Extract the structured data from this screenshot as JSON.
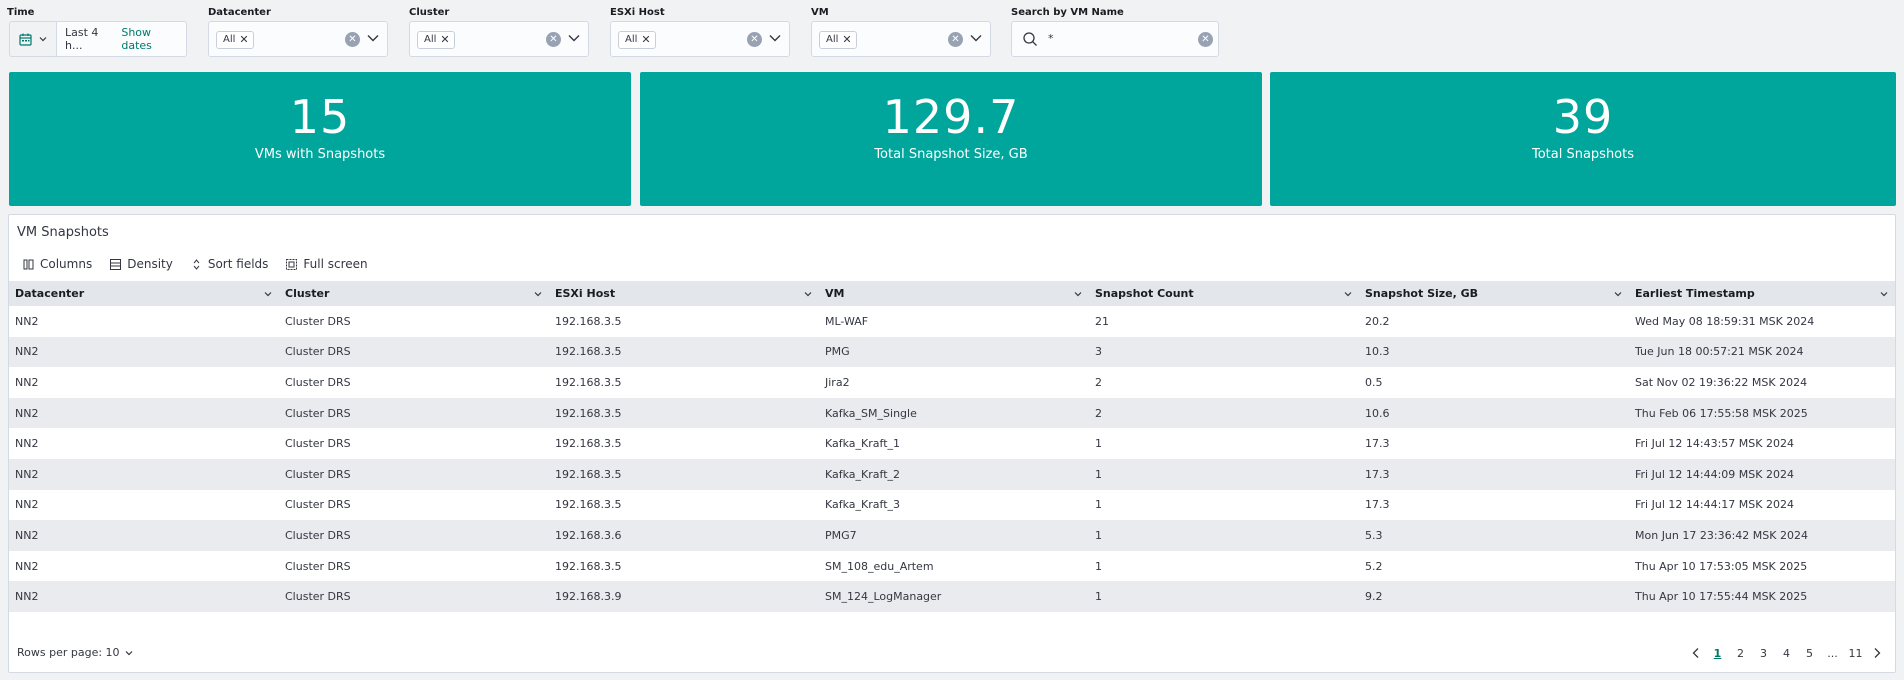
{
  "filters": {
    "time": {
      "label": "Time",
      "value": "Last 4 h...",
      "show_dates": "Show dates"
    },
    "datacenter": {
      "label": "Datacenter",
      "chip": "All"
    },
    "cluster": {
      "label": "Cluster",
      "chip": "All"
    },
    "esxi_host": {
      "label": "ESXi Host",
      "chip": "All"
    },
    "vm": {
      "label": "VM",
      "chip": "All"
    },
    "search": {
      "label": "Search by VM Name",
      "value": "*"
    }
  },
  "stats": [
    {
      "value": "15",
      "label": "VMs with Snapshots"
    },
    {
      "value": "129.7",
      "label": "Total Snapshot Size, GB"
    },
    {
      "value": "39",
      "label": "Total Snapshots"
    }
  ],
  "panel": {
    "title": "VM Snapshots",
    "toolbar": {
      "columns": "Columns",
      "density": "Density",
      "sort": "Sort fields",
      "fullscreen": "Full screen"
    },
    "columns": [
      "Datacenter",
      "Cluster",
      "ESXi Host",
      "VM",
      "Snapshot Count",
      "Snapshot Size, GB",
      "Earliest Timestamp"
    ],
    "rows": [
      [
        "NN2",
        "Cluster DRS",
        "192.168.3.5",
        "ML-WAF",
        "21",
        "20.2",
        "Wed May 08 18:59:31 MSK 2024"
      ],
      [
        "NN2",
        "Cluster DRS",
        "192.168.3.5",
        "PMG",
        "3",
        "10.3",
        "Tue Jun 18 00:57:21 MSK 2024"
      ],
      [
        "NN2",
        "Cluster DRS",
        "192.168.3.5",
        "Jira2",
        "2",
        "0.5",
        "Sat Nov 02 19:36:22 MSK 2024"
      ],
      [
        "NN2",
        "Cluster DRS",
        "192.168.3.5",
        "Kafka_SM_Single",
        "2",
        "10.6",
        "Thu Feb 06 17:55:58 MSK 2025"
      ],
      [
        "NN2",
        "Cluster DRS",
        "192.168.3.5",
        "Kafka_Kraft_1",
        "1",
        "17.3",
        "Fri Jul 12 14:43:57 MSK 2024"
      ],
      [
        "NN2",
        "Cluster DRS",
        "192.168.3.5",
        "Kafka_Kraft_2",
        "1",
        "17.3",
        "Fri Jul 12 14:44:09 MSK 2024"
      ],
      [
        "NN2",
        "Cluster DRS",
        "192.168.3.5",
        "Kafka_Kraft_3",
        "1",
        "17.3",
        "Fri Jul 12 14:44:17 MSK 2024"
      ],
      [
        "NN2",
        "Cluster DRS",
        "192.168.3.6",
        "PMG7",
        "1",
        "5.3",
        "Mon Jun 17 23:36:42 MSK 2024"
      ],
      [
        "NN2",
        "Cluster DRS",
        "192.168.3.5",
        "SM_108_edu_Artem",
        "1",
        "5.2",
        "Thu Apr 10 17:53:05 MSK 2025"
      ],
      [
        "NN2",
        "Cluster DRS",
        "192.168.3.9",
        "SM_124_LogManager",
        "1",
        "9.2",
        "Thu Apr 10 17:55:44 MSK 2025"
      ]
    ],
    "rows_per_page": "Rows per page: 10",
    "pages": [
      "1",
      "2",
      "3",
      "4",
      "5",
      "...",
      "11"
    ],
    "current_page": "1"
  },
  "colors": {
    "card": "#00a69b",
    "accent": "#00796b"
  }
}
